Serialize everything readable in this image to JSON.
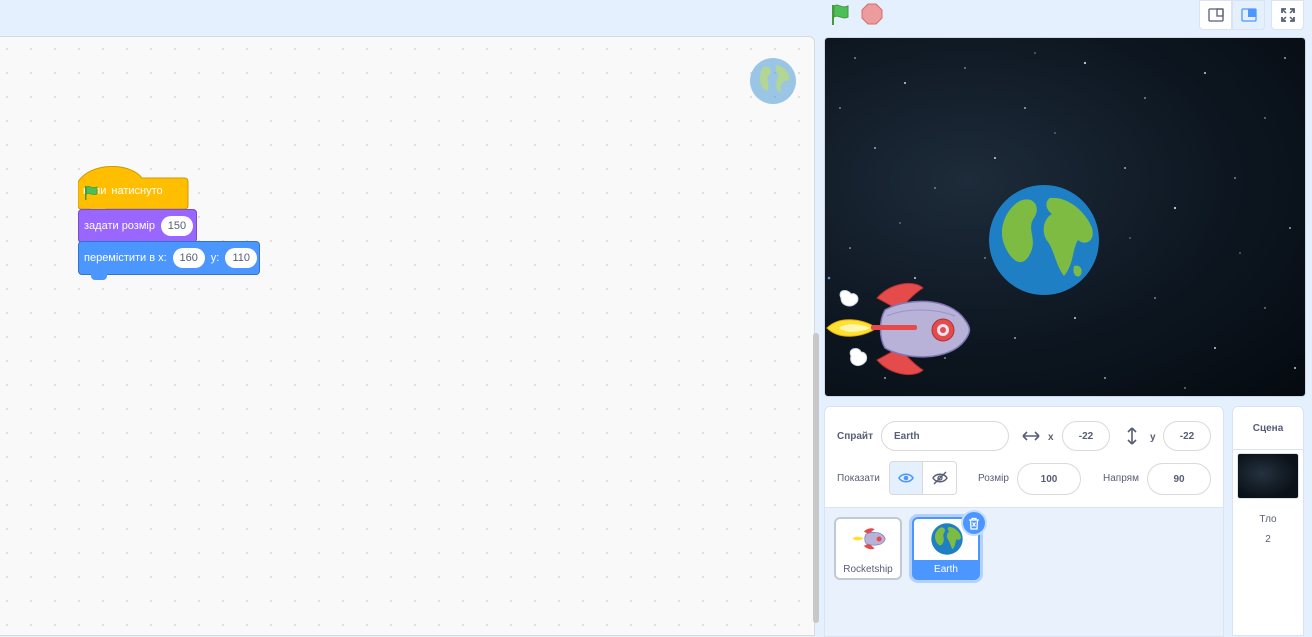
{
  "code": {
    "hat_block": {
      "text_before": "коли",
      "text_after": "натиснуто",
      "flag_icon": "green-flag-icon"
    },
    "size_block": {
      "label": "задати розмір",
      "value": "150"
    },
    "move_block": {
      "label": "перемістити в x:",
      "x_value": "160",
      "y_label": "y:",
      "y_value": "110"
    }
  },
  "sprite_info": {
    "sprite_label": "Спрайт",
    "sprite_name": "Earth",
    "x_label": "x",
    "x_value": "-22",
    "y_label": "y",
    "y_value": "-22",
    "show_label": "Показати",
    "size_label": "Розмір",
    "size_value": "100",
    "direction_label": "Напрям",
    "direction_value": "90"
  },
  "sprites": [
    {
      "name": "Rocketship",
      "selected": false
    },
    {
      "name": "Earth",
      "selected": true
    }
  ],
  "stage_selector": {
    "title": "Сцена",
    "backdrops_label": "Тло",
    "backdrops_count": "2"
  },
  "colors": {
    "motion": "#4c97ff",
    "looks": "#9966ff",
    "events": "#ffbf00",
    "accent": "#4c97ff"
  }
}
